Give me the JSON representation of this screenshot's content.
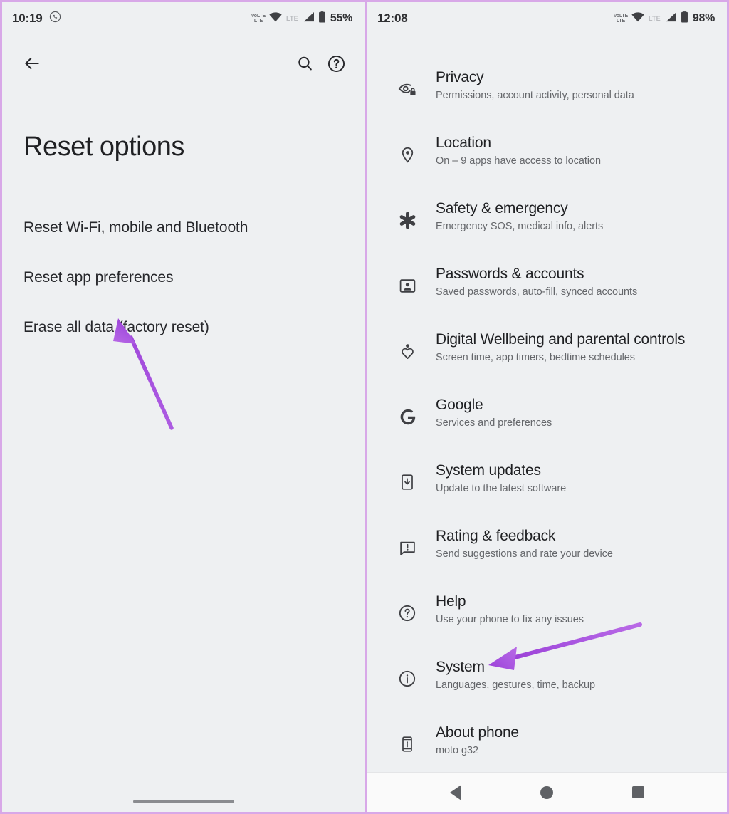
{
  "left_phone": {
    "status_bar": {
      "clock": "10:19",
      "app_icon": "whatsapp-icon",
      "volte_top": "VoLTE",
      "volte_bottom": "LTE",
      "wifi_icon": "wifi-icon",
      "network_label": "LTE",
      "signal_icon": "signal-bars-icon",
      "battery_icon": "battery-icon",
      "battery_percent": "55%"
    },
    "appbar": {
      "back_icon": "arrow-back-icon",
      "search_icon": "search-icon",
      "help_icon": "help-circle-icon"
    },
    "title": "Reset options",
    "options": [
      {
        "label": "Reset Wi-Fi, mobile and Bluetooth"
      },
      {
        "label": "Reset app preferences"
      },
      {
        "label": "Erase all data (factory reset)"
      }
    ]
  },
  "right_phone": {
    "status_bar": {
      "clock": "12:08",
      "volte_top": "VoLTE",
      "volte_bottom": "LTE",
      "wifi_icon": "wifi-icon",
      "network_label": "LTE",
      "signal_icon": "signal-bars-icon",
      "battery_icon": "battery-icon",
      "battery_percent": "98%"
    },
    "settings": [
      {
        "icon": "privacy-eye-lock-icon",
        "title": "Privacy",
        "subtitle": "Permissions, account activity, personal data"
      },
      {
        "icon": "location-pin-icon",
        "title": "Location",
        "subtitle": "On – 9 apps have access to location"
      },
      {
        "icon": "safety-asterisk-icon",
        "title": "Safety & emergency",
        "subtitle": "Emergency SOS, medical info, alerts"
      },
      {
        "icon": "passwords-account-icon",
        "title": "Passwords & accounts",
        "subtitle": "Saved passwords, auto-fill, synced accounts"
      },
      {
        "icon": "digital-wellbeing-icon",
        "title": "Digital Wellbeing and parental controls",
        "subtitle": "Screen time, app timers, bedtime schedules"
      },
      {
        "icon": "google-g-icon",
        "title": "Google",
        "subtitle": "Services and preferences"
      },
      {
        "icon": "system-updates-icon",
        "title": "System updates",
        "subtitle": "Update to the latest software"
      },
      {
        "icon": "rating-feedback-icon",
        "title": "Rating & feedback",
        "subtitle": "Send suggestions and rate your device"
      },
      {
        "icon": "help-circle-icon",
        "title": "Help",
        "subtitle": "Use your phone to fix any issues"
      },
      {
        "icon": "system-info-icon",
        "title": "System",
        "subtitle": "Languages, gestures, time, backup"
      },
      {
        "icon": "about-phone-icon",
        "title": "About phone",
        "subtitle": "moto g32"
      }
    ],
    "navbar": {
      "back_icon": "nav-back-triangle-icon",
      "home_icon": "nav-home-circle-icon",
      "recents_icon": "nav-recents-square-icon"
    }
  },
  "annotations": {
    "arrow_color": "#a855e0",
    "left_arrow_target": "Erase all data (factory reset)",
    "right_arrow_target": "System"
  },
  "colors": {
    "panel_background": "#eef0f2",
    "panel_border": "#d8a8e8",
    "title_text": "#1f2023",
    "subtitle_text": "#65676b",
    "navbar_background": "#fafafa",
    "accent_purple": "#a855e0"
  }
}
